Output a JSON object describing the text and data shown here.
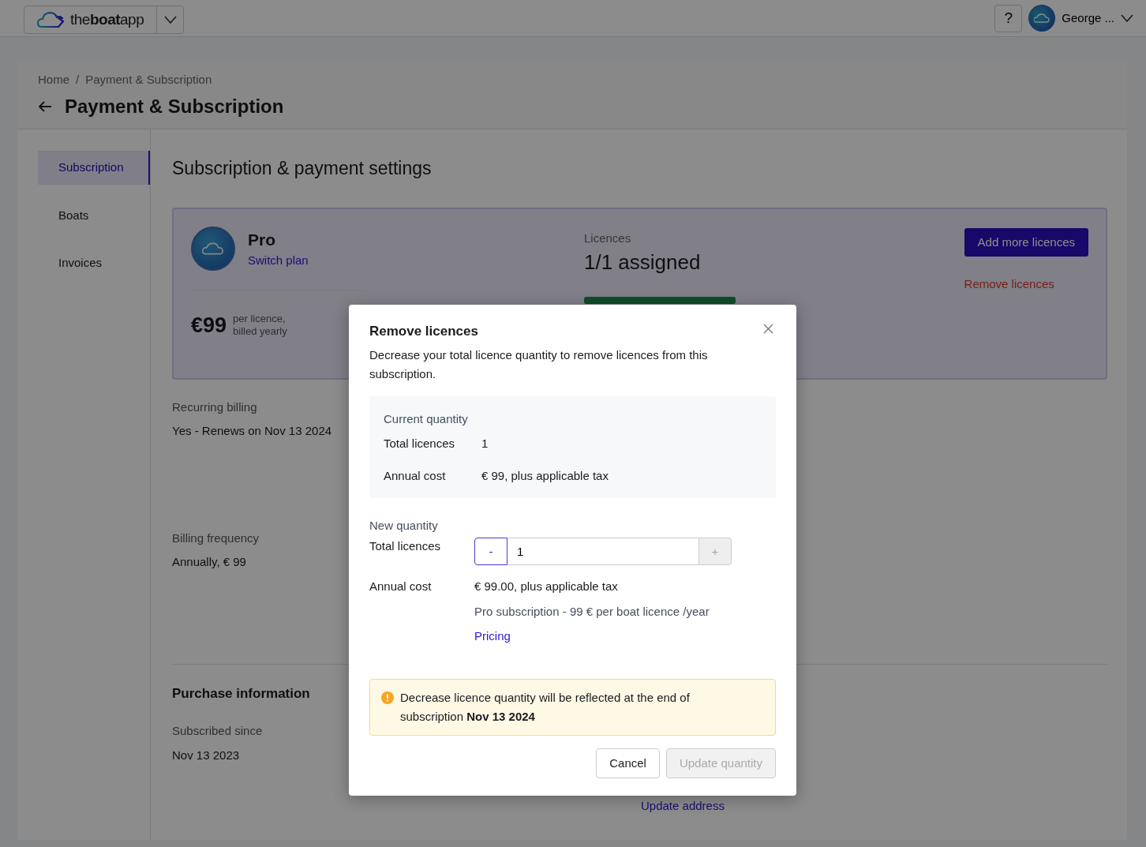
{
  "top_bar": {
    "logo": "the**boat**app",
    "help": "?",
    "user": "George ..."
  },
  "breadcrumb": {
    "items": [
      "Home",
      "Payment & Subscription"
    ],
    "separator": "/"
  },
  "page_title": "Payment & Subscription",
  "sidebar": {
    "items": [
      {
        "label": "Subscription",
        "selected": true
      },
      {
        "label": "Boats",
        "selected": false
      },
      {
        "label": "Invoices",
        "selected": false
      }
    ]
  },
  "section_title": "Subscription & payment settings",
  "plan": {
    "name": "Pro",
    "switch_link": "Switch plan",
    "price": "€99",
    "price_note": [
      "per licence,",
      "billed yearly"
    ]
  },
  "licences": {
    "label": "Licences",
    "value": "1/1 assigned",
    "level": 1
  },
  "plan_actions": {
    "add_button": "Add more licences",
    "remove_link": "Remove licences"
  },
  "billing": [
    {
      "label": "Recurring billing",
      "value": "Yes - Renews on Nov 13 2024"
    },
    {
      "label": "Billing frequency",
      "value": "Annually, € 99"
    }
  ],
  "purchase": {
    "title": "Purchase information",
    "rows": [
      {
        "label": "Subscribed since",
        "value": "Nov 13 2023"
      }
    ],
    "address_link": "Update address"
  },
  "modal": {
    "title": "Remove licences",
    "description": "Decrease your total licence quantity to remove licences from this subscription.",
    "current": {
      "heading": "Current quantity",
      "rows": [
        {
          "label": "Total licences",
          "value": "1"
        },
        {
          "label": "Annual cost",
          "value": "€ 99, plus applicable tax"
        }
      ]
    },
    "new": {
      "heading": "New quantity",
      "total_label": "Total licences",
      "minus": {
        "label": "-",
        "focused": true,
        "disabled": false
      },
      "quantity": "1",
      "plus": {
        "label": "+",
        "focused": false,
        "disabled": true
      },
      "cost_label": "Annual cost",
      "cost_value": "€ 99.00, plus applicable tax",
      "cost_note": "Pro subscription - 99 € per boat licence /year",
      "pricing_link": "Pricing"
    },
    "alert": "Decrease licence quantity will be reflected at the end of subscription **Nov 13 2024**",
    "buttons": [
      {
        "label": "Cancel",
        "kind": "secondary",
        "disabled": false
      },
      {
        "label": "Update quantity",
        "kind": "primary",
        "disabled": true
      }
    ]
  }
}
